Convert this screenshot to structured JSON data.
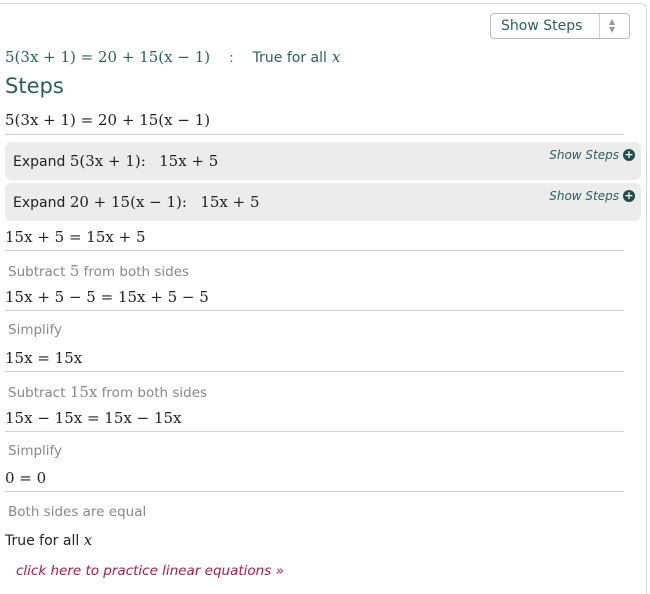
{
  "dropdown": {
    "selected": "Show Steps"
  },
  "result": {
    "equation": "5(3x + 1) = 20 + 15(x − 1)",
    "separator": ":",
    "answer_text": "True for all",
    "answer_var": "x"
  },
  "steps_heading": "Steps",
  "initial_equation": "5(3x + 1) = 20 + 15(x − 1)",
  "expand_boxes": [
    {
      "prefix": "Expand",
      "expr": "5(3x + 1):",
      "result": "15x + 5",
      "show_steps": "Show Steps",
      "icon": "plus-circle-icon"
    },
    {
      "prefix": "Expand",
      "expr": "20 + 15(x − 1):",
      "result": "15x + 5",
      "show_steps": "Show Steps",
      "icon": "plus-circle-icon"
    }
  ],
  "after_expand": "15x + 5 = 15x + 5",
  "steps": [
    {
      "label_pre": "Subtract",
      "label_math": "5",
      "label_post": "from both sides",
      "equation": "15x + 5 − 5 = 15x + 5 − 5"
    },
    {
      "label_pre": "Simplify",
      "label_math": "",
      "label_post": "",
      "equation": "15x = 15x"
    },
    {
      "label_pre": "Subtract",
      "label_math": "15x",
      "label_post": "from both sides",
      "equation": "15x − 15x = 15x − 15x"
    },
    {
      "label_pre": "Simplify",
      "label_math": "",
      "label_post": "",
      "equation": "0 = 0"
    }
  ],
  "conclusion_label": "Both sides are equal",
  "final": {
    "text": "True for all",
    "var": "x"
  },
  "practice_link": "click here to practice linear equations »"
}
